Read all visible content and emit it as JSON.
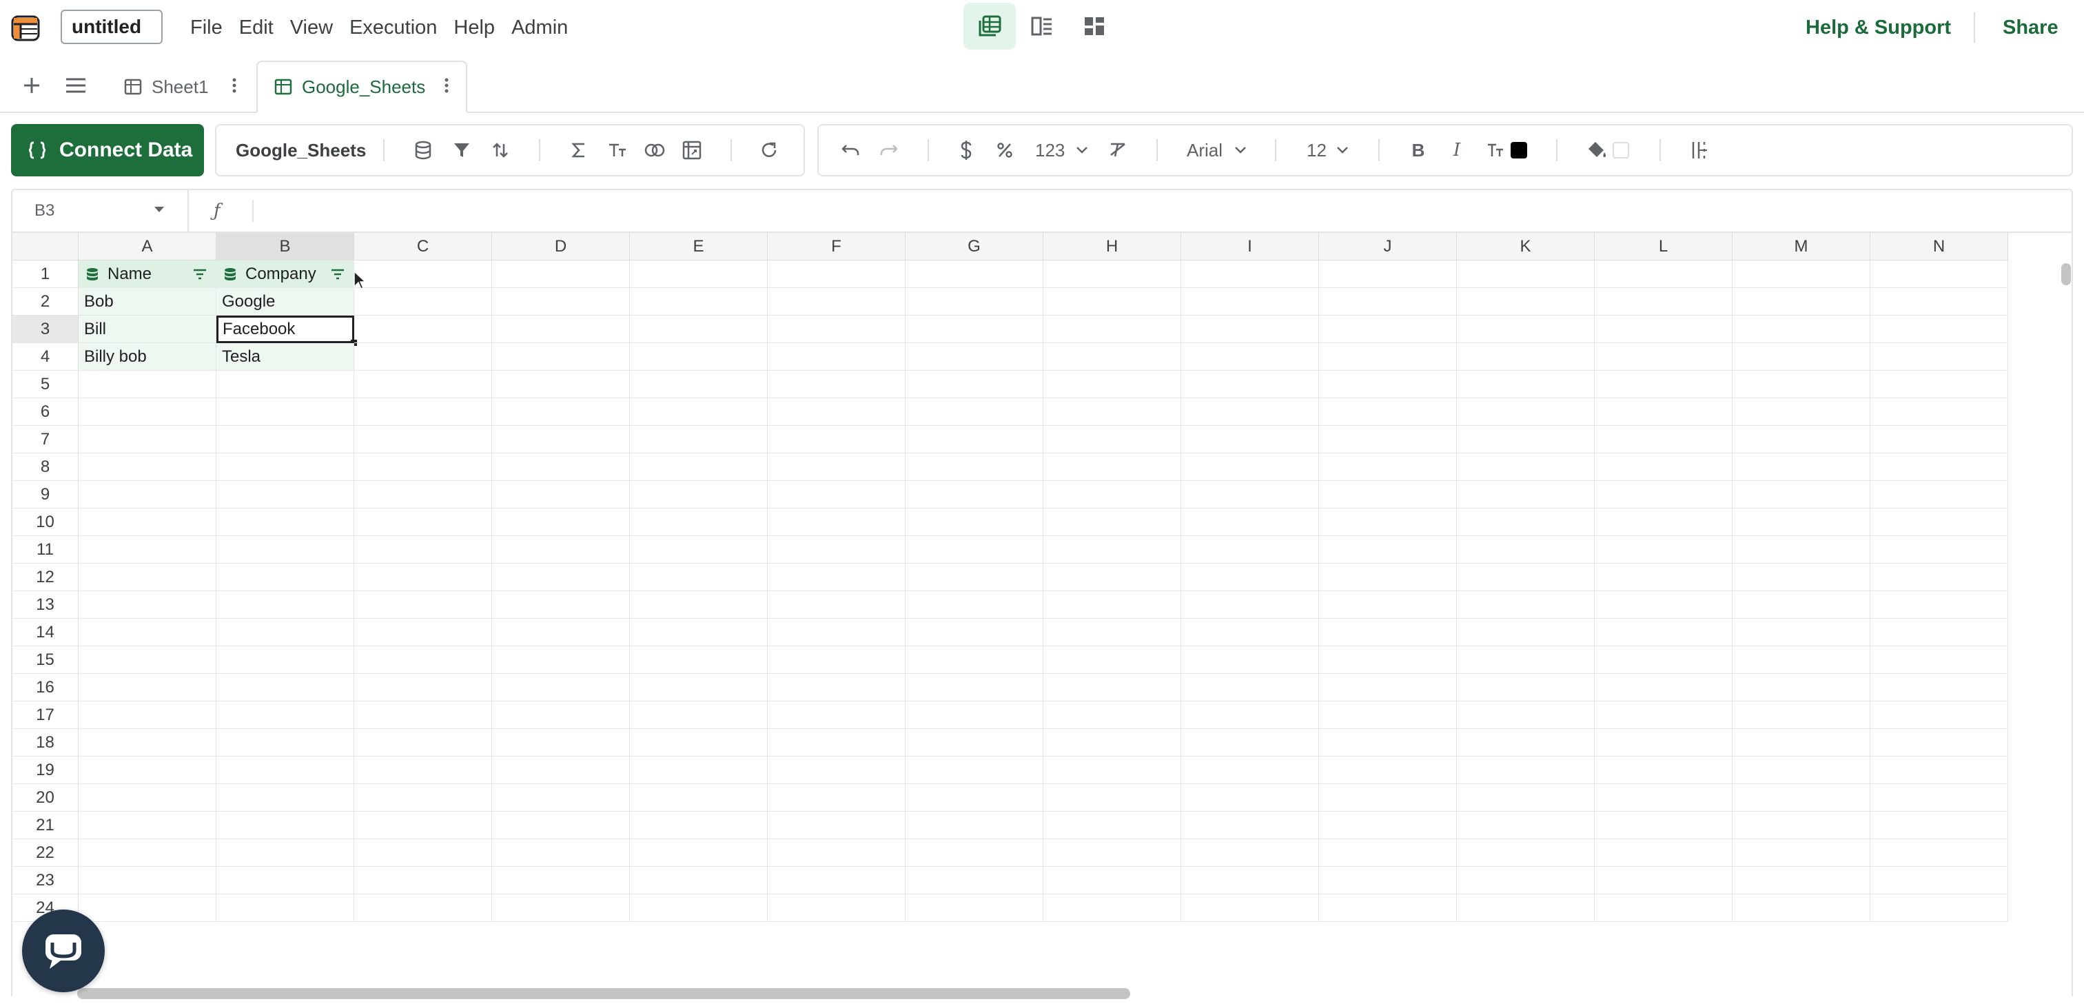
{
  "app": {
    "doc_title": "untitled",
    "menu": [
      "File",
      "Edit",
      "View",
      "Execution",
      "Help",
      "Admin"
    ],
    "help_support": "Help & Support",
    "share": "Share"
  },
  "tabs": {
    "sheets": [
      {
        "label": "Sheet1",
        "active": false
      },
      {
        "label": "Google_Sheets",
        "active": true
      }
    ]
  },
  "toolbar": {
    "connect_label": "Connect Data",
    "source_name": "Google_Sheets",
    "number_format": "123",
    "font_family": "Arial",
    "font_size": "12",
    "text_color": "#000000",
    "fill_color": "#ffffff",
    "accent": "#1e6e3c"
  },
  "formula": {
    "cell_ref": "B3",
    "fx": "ƒ",
    "value": ""
  },
  "grid": {
    "columns": [
      "A",
      "B",
      "C",
      "D",
      "E",
      "F",
      "G",
      "H",
      "I",
      "J",
      "K",
      "L",
      "M",
      "N"
    ],
    "rows": [
      "1",
      "2",
      "3",
      "4",
      "5",
      "6",
      "7",
      "8",
      "9",
      "10",
      "11",
      "12",
      "13",
      "14",
      "15",
      "16",
      "17",
      "18",
      "19",
      "20",
      "21",
      "22",
      "23",
      "24"
    ],
    "header_cells": [
      "Name",
      "Company"
    ],
    "data": [
      [
        "Bob",
        "Google"
      ],
      [
        "Bill",
        "Facebook"
      ],
      [
        "Billy bob",
        "Tesla"
      ]
    ],
    "active_cell": "B3"
  }
}
